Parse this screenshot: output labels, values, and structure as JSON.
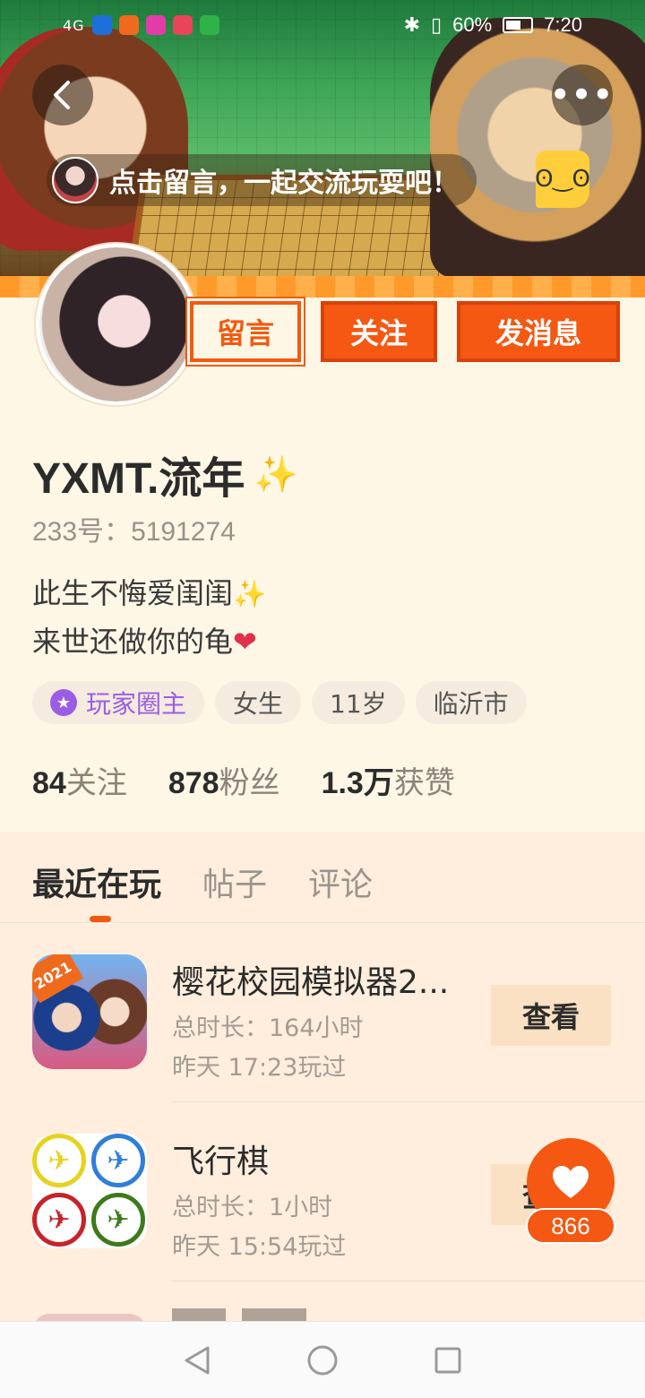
{
  "status_bar": {
    "network": "4G",
    "battery": "60%",
    "time": "7:20"
  },
  "header": {
    "message_prompt": "点击留言，一起交流玩耍吧！"
  },
  "actions": {
    "leave_message": "留言",
    "follow": "关注",
    "send_message": "发消息"
  },
  "profile": {
    "username": "YXMT.流年",
    "uid_label": "233号：",
    "uid": "5191274",
    "bio_line1": "此生不悔爱闺闺",
    "bio_line2": "来世还做你的龟",
    "tags": [
      "玩家圈主",
      "女生",
      "11岁",
      "临沂市"
    ],
    "stats": [
      {
        "num": "84",
        "label": "关注"
      },
      {
        "num": "878",
        "label": "粉丝"
      },
      {
        "num": "1.3万",
        "label": "获赞"
      }
    ]
  },
  "tabs": [
    "最近在玩",
    "帖子",
    "评论"
  ],
  "games": [
    {
      "title": "樱花校园模拟器2...",
      "duration": "总时长：164小时",
      "last_played": "昨天 17:23玩过",
      "action": "查看",
      "icon_badge": "2021"
    },
    {
      "title": "飞行棋",
      "duration": "总时长：1小时",
      "last_played": "昨天 15:54玩过",
      "action": "查看"
    }
  ],
  "likes": {
    "count": "866"
  },
  "icons": {
    "back": "back-icon",
    "more": "more-icon",
    "like": "heart-icon",
    "nav_back": "triangle-back-icon",
    "nav_home": "circle-home-icon",
    "nav_recent": "square-recent-icon"
  },
  "colors": {
    "accent": "#f45812",
    "background": "#fff7e6",
    "purple_badge": "#9b5de5"
  }
}
